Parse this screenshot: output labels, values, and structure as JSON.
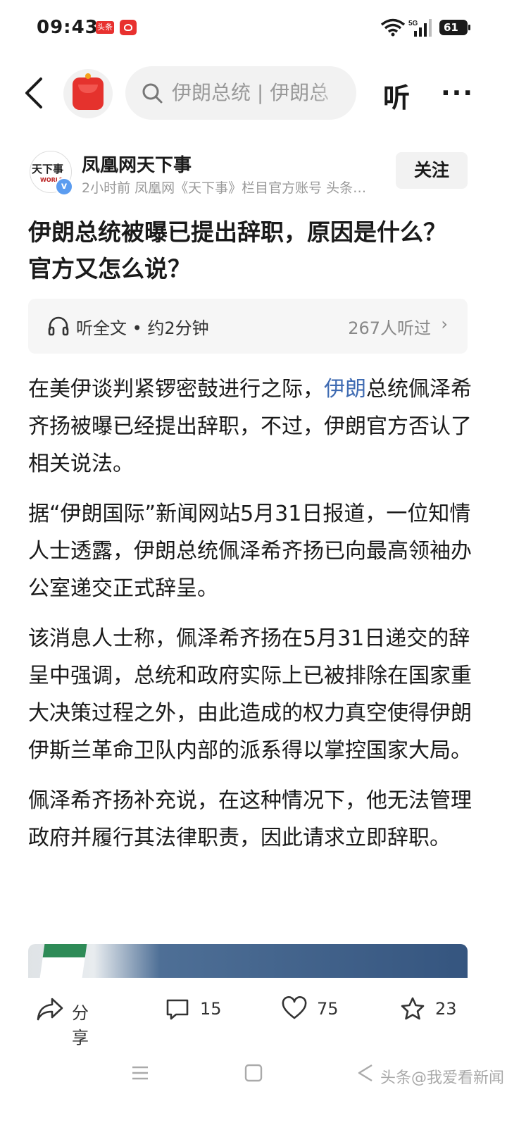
{
  "status_bar": {
    "time": "09:43",
    "app_badge": "头条",
    "network": "5G",
    "battery": "61"
  },
  "top_nav": {
    "search_placeholder": "伊朗总统 | 伊朗总",
    "listen_label": "听",
    "more_label": "···"
  },
  "author": {
    "name": "凤凰网天下事",
    "meta": "2小时前  凤凰网《天下事》栏目官方账号 头条…",
    "avatar_text": "天下事",
    "avatar_sub": "WORLD",
    "follow_label": "关注"
  },
  "article": {
    "title": "伊朗总统被曝已提出辞职，原因是什么？官方又怎么说？",
    "audio_label": "听全文 • 约2分钟",
    "audio_count": "267人听过",
    "p1_before": "在美伊谈判紧锣密鼓进行之际，",
    "p1_link": "伊朗",
    "p1_after": "总统佩泽希齐扬被曝已经提出辞职，不过，伊朗官方否认了相关说法。",
    "p2": "据“伊朗国际”新闻网站5月31日报道，一位知情人士透露，伊朗总统佩泽希齐扬已向最高领袖办公室递交正式辞呈。",
    "p3": "该消息人士称，佩泽希齐扬在5月31日递交的辞呈中强调，总统和政府实际上已被排除在国家重大决策过程之外，由此造成的权力真空使得伊朗伊斯兰革命卫队内部的派系得以掌控国家大局。",
    "p4": "佩泽希齐扬补充说，在这种情况下，他无法管理政府并履行其法律职责，因此请求立即辞职。"
  },
  "actions": {
    "share": "分享",
    "comments": "15",
    "likes": "75",
    "favorites": "23"
  },
  "watermark": "头条@我爱看新闻"
}
